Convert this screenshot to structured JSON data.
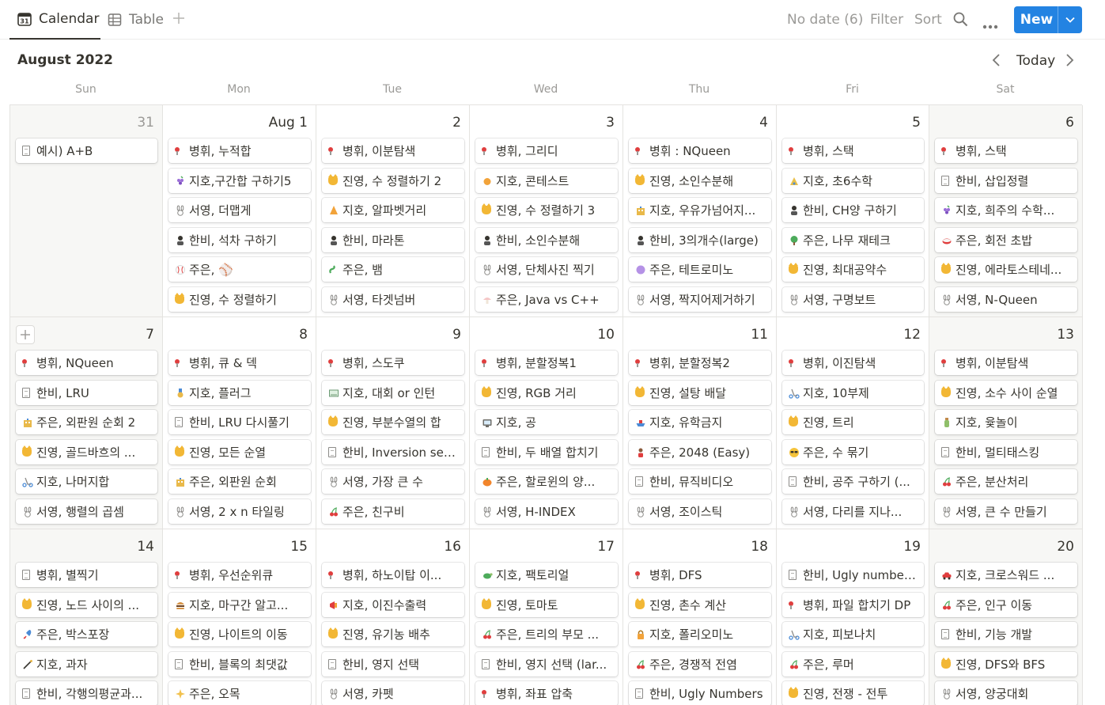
{
  "tabs": {
    "calendar": "Calendar",
    "table": "Table",
    "calendar_icon_text": "31"
  },
  "toolbar": {
    "no_date": "No date (6)",
    "filter": "Filter",
    "sort": "Sort",
    "new": "New"
  },
  "header": {
    "month": "August 2022",
    "today": "Today"
  },
  "weekdays": [
    "Sun",
    "Mon",
    "Tue",
    "Wed",
    "Thu",
    "Fri",
    "Sat"
  ],
  "colors": {
    "accent": "#2383e2",
    "weekend_bg": "#f7f7f5",
    "border": "#e4e3e0"
  },
  "weeks": [
    {
      "days": [
        {
          "label": "31",
          "muted": true,
          "events": [
            {
              "icon": "doc",
              "text": "예시) A+B"
            }
          ]
        },
        {
          "label": "Aug 1",
          "events": [
            {
              "icon": "pin",
              "text": "병휘, 누적합"
            },
            {
              "icon": "grapes",
              "text": "지호,구간합 구하기5"
            },
            {
              "icon": "bunny",
              "text": "서영, 더맵게"
            },
            {
              "icon": "person",
              "text": "한비, 석차 구하기"
            },
            {
              "icon": "ball",
              "text": "주은, ⚾"
            },
            {
              "icon": "cat",
              "text": "진영, 수 정렬하기"
            }
          ]
        },
        {
          "label": "2",
          "events": [
            {
              "icon": "pin",
              "text": "병휘, 이분탐색"
            },
            {
              "icon": "cat",
              "text": "진영, 수 정렬하기 2"
            },
            {
              "icon": "hat",
              "text": "지호, 알파벳거리"
            },
            {
              "icon": "person",
              "text": "한비, 마라톤"
            },
            {
              "icon": "snake",
              "text": "주은, 뱀"
            },
            {
              "icon": "bunny",
              "text": "서영, 타겟넘버"
            }
          ]
        },
        {
          "label": "3",
          "events": [
            {
              "icon": "pin",
              "text": "병휘, 그리디"
            },
            {
              "icon": "orange",
              "text": "지호, 콘테스트"
            },
            {
              "icon": "cat",
              "text": "진영, 수 정렬하기 3"
            },
            {
              "icon": "person",
              "text": "한비, 소인수분해"
            },
            {
              "icon": "bunny",
              "text": "서영, 단체사진 찍기"
            },
            {
              "icon": "mushroom",
              "text": "주은, Java vs C++"
            }
          ]
        },
        {
          "label": "4",
          "events": [
            {
              "icon": "pin",
              "text": "병휘 : NQueen"
            },
            {
              "icon": "cat",
              "text": "진영, 소인수분해"
            },
            {
              "icon": "building",
              "text": "지호, 우유가넘어지..."
            },
            {
              "icon": "person",
              "text": "한비, 3의개수(large)"
            },
            {
              "icon": "purple",
              "text": "주은, 테트로미노"
            },
            {
              "icon": "bunny",
              "text": "서영, 짝지어제거하기"
            }
          ]
        },
        {
          "label": "5",
          "events": [
            {
              "icon": "pin",
              "text": "병휘, 스택"
            },
            {
              "icon": "hat2",
              "text": "지호, 초6수학"
            },
            {
              "icon": "person",
              "text": "한비, CH양 구하기"
            },
            {
              "icon": "tree",
              "text": "주은, 나무 재테크"
            },
            {
              "icon": "cat",
              "text": "진영, 최대공약수"
            },
            {
              "icon": "bunny",
              "text": "서영, 구명보트"
            }
          ]
        },
        {
          "label": "6",
          "events": [
            {
              "icon": "pin",
              "text": "병휘, 스택"
            },
            {
              "icon": "doc",
              "text": "한비, 삽입정렬"
            },
            {
              "icon": "grapes",
              "text": "지호, 희주의 수학..."
            },
            {
              "icon": "sushi",
              "text": "주은, 회전 초밥"
            },
            {
              "icon": "cat",
              "text": "진영, 에라토스테네..."
            },
            {
              "icon": "bunny",
              "text": "서영, N-Queen"
            }
          ]
        }
      ]
    },
    {
      "days": [
        {
          "label": "7",
          "plus": true,
          "events": [
            {
              "icon": "pin",
              "text": "병휘, NQueen"
            },
            {
              "icon": "doc",
              "text": "한비, LRU"
            },
            {
              "icon": "building",
              "text": "주은, 외판원 순회 2"
            },
            {
              "icon": "cat",
              "text": "진영, 골드바흐의 ..."
            },
            {
              "icon": "scooter",
              "text": "지호, 나머지합"
            },
            {
              "icon": "bunny",
              "text": "서영, 행렬의 곱셈"
            }
          ]
        },
        {
          "label": "8",
          "events": [
            {
              "icon": "pin",
              "text": "병휘, 큐 & 덱"
            },
            {
              "icon": "medal",
              "text": "지호, 플러그"
            },
            {
              "icon": "doc",
              "text": "한비, LRU 다시풀기"
            },
            {
              "icon": "cat",
              "text": "진영, 모든 순열"
            },
            {
              "icon": "building",
              "text": "주은, 외판원 순회"
            },
            {
              "icon": "bunny",
              "text": "서영, 2 x n 타일링"
            }
          ]
        },
        {
          "label": "9",
          "events": [
            {
              "icon": "pin",
              "text": "병휘, 스도쿠"
            },
            {
              "icon": "board",
              "text": "지호, 대회 or 인턴"
            },
            {
              "icon": "cat",
              "text": "진영, 부분수열의 합"
            },
            {
              "icon": "doc",
              "text": "한비, Inversion seq..."
            },
            {
              "icon": "bunny",
              "text": "서영, 가장 큰 수"
            },
            {
              "icon": "cherry",
              "text": "주은, 친구비"
            }
          ]
        },
        {
          "label": "10",
          "events": [
            {
              "icon": "pin",
              "text": "병휘, 분할정복1"
            },
            {
              "icon": "cat",
              "text": "진영, RGB 거리"
            },
            {
              "icon": "tv",
              "text": "지호, 공"
            },
            {
              "icon": "doc",
              "text": "한비, 두 배열 합치기"
            },
            {
              "icon": "pumpkin",
              "text": "주은, 할로윈의 양..."
            },
            {
              "icon": "bunny",
              "text": "서영, H-INDEX"
            }
          ]
        },
        {
          "label": "11",
          "events": [
            {
              "icon": "pin",
              "text": "병휘, 분할정복2"
            },
            {
              "icon": "cat",
              "text": "진영, 설탕 배달"
            },
            {
              "icon": "ship",
              "text": "지호, 유학금지"
            },
            {
              "icon": "person2",
              "text": "주은, 2048 (Easy)"
            },
            {
              "icon": "doc",
              "text": "한비, 뮤직비디오"
            },
            {
              "icon": "bunny",
              "text": "서영, 조이스틱"
            }
          ]
        },
        {
          "label": "12",
          "events": [
            {
              "icon": "pin",
              "text": "병휘, 이진탐색"
            },
            {
              "icon": "scooter",
              "text": "지호, 10부제"
            },
            {
              "icon": "cat",
              "text": "진영, 트리"
            },
            {
              "icon": "sunglasses",
              "text": "주은, 수 묶기"
            },
            {
              "icon": "doc",
              "text": "한비, 공주 구하기 (..."
            },
            {
              "icon": "bunny",
              "text": "서영, 다리를 지나..."
            }
          ]
        },
        {
          "label": "13",
          "events": [
            {
              "icon": "pin",
              "text": "병휘, 이분탐색"
            },
            {
              "icon": "cat",
              "text": "진영, 소수 사이 순열"
            },
            {
              "icon": "bottle",
              "text": "지호, 윷놀이"
            },
            {
              "icon": "doc",
              "text": "한비, 멀티태스킹"
            },
            {
              "icon": "cherry",
              "text": "주은, 분산처리"
            },
            {
              "icon": "bunny",
              "text": "서영, 큰 수 만들기"
            }
          ]
        }
      ]
    },
    {
      "days": [
        {
          "label": "14",
          "events": [
            {
              "icon": "doc",
              "text": "병휘, 별찍기"
            },
            {
              "icon": "cat",
              "text": "진영, 노드 사이의 ..."
            },
            {
              "icon": "rocket",
              "text": "주은, 박스포장"
            },
            {
              "icon": "wand",
              "text": "지호, 과자"
            },
            {
              "icon": "doc",
              "text": "한비, 각행의평균과..."
            }
          ]
        },
        {
          "label": "15",
          "events": [
            {
              "icon": "pin",
              "text": "병휘, 우선순위큐"
            },
            {
              "icon": "burger",
              "text": "지호, 마구간 알고..."
            },
            {
              "icon": "cat",
              "text": "진영, 나이트의 이동"
            },
            {
              "icon": "doc",
              "text": "한비, 블록의 최댓값"
            },
            {
              "icon": "sparkle",
              "text": "주은, 오목"
            }
          ]
        },
        {
          "label": "16",
          "events": [
            {
              "icon": "pin",
              "text": "병휘, 하노이탑 이..."
            },
            {
              "icon": "megaphone",
              "text": "지호, 이진수출력"
            },
            {
              "icon": "cat",
              "text": "진영, 유기농 배추"
            },
            {
              "icon": "doc",
              "text": "한비, 영지 선택"
            },
            {
              "icon": "bunny",
              "text": "서영, 카펫"
            }
          ]
        },
        {
          "label": "17",
          "events": [
            {
              "icon": "turtle",
              "text": "지호, 팩토리얼"
            },
            {
              "icon": "cat",
              "text": "진영, 토마토"
            },
            {
              "icon": "cherry",
              "text": "주은, 트리의 부모 ..."
            },
            {
              "icon": "doc",
              "text": "한비, 영지 선택 (lar..."
            },
            {
              "icon": "pin",
              "text": "병휘, 좌표 압축"
            }
          ]
        },
        {
          "label": "18",
          "events": [
            {
              "icon": "pin",
              "text": "병휘, DFS"
            },
            {
              "icon": "cat",
              "text": "진영, 촌수 계산"
            },
            {
              "icon": "lock",
              "text": "지호, 폴리오미노"
            },
            {
              "icon": "cherry",
              "text": "주은, 경쟁적 전염"
            },
            {
              "icon": "doc",
              "text": "한비, Ugly Numbers"
            }
          ]
        },
        {
          "label": "19",
          "events": [
            {
              "icon": "doc",
              "text": "한비, Ugly number 2"
            },
            {
              "icon": "pin",
              "text": "병휘, 파일 합치기 DP"
            },
            {
              "icon": "scooter",
              "text": "지호, 피보나치"
            },
            {
              "icon": "cherry",
              "text": "주은, 루머"
            },
            {
              "icon": "cat",
              "text": "진영, 전쟁 - 전투"
            }
          ]
        },
        {
          "label": "20",
          "events": [
            {
              "icon": "car",
              "text": "지호, 크로스워드 ..."
            },
            {
              "icon": "cherry",
              "text": "주은, 인구 이동"
            },
            {
              "icon": "doc",
              "text": "한비, 기능 개발"
            },
            {
              "icon": "cat",
              "text": "진영, DFS와 BFS"
            },
            {
              "icon": "bunny",
              "text": "서영, 양궁대회"
            }
          ]
        }
      ]
    }
  ]
}
